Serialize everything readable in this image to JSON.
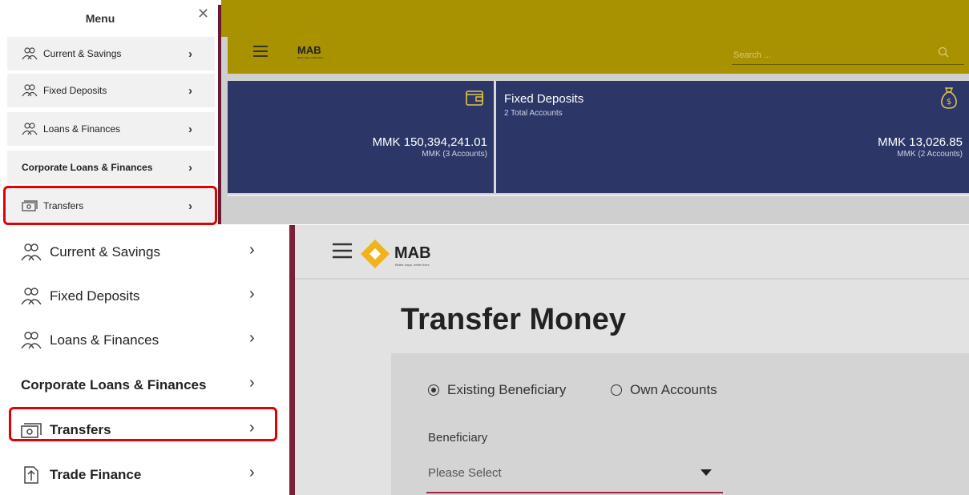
{
  "top_menu": {
    "title": "Menu",
    "close_glyph": "✕",
    "items": [
      {
        "label": "Current & Savings",
        "icon": "users-icon"
      },
      {
        "label": "Fixed Deposits",
        "icon": "users-icon"
      },
      {
        "label": "Loans & Finances",
        "icon": "users-icon"
      },
      {
        "label": "Corporate Loans & Finances",
        "icon": ""
      },
      {
        "label": "Transfers",
        "icon": "cash-icon"
      }
    ],
    "chevron": "›"
  },
  "top_app": {
    "logo": "MAB",
    "logo_tagline": "Better ways, better lives",
    "search_placeholder": "Search ...",
    "cards": [
      {
        "amount": "MMK 150,394,241.01",
        "sub": "MMK (3 Accounts)",
        "icon": "wallet-icon"
      },
      {
        "title": "Fixed Deposits",
        "subtitle": "2 Total Accounts",
        "amount": "MMK 13,026.85",
        "sub": "MMK (2 Accounts)",
        "icon": "money-bag-icon"
      }
    ]
  },
  "bottom_menu": {
    "items": [
      {
        "label": "Current & Savings",
        "icon": "users-icon"
      },
      {
        "label": "Fixed Deposits",
        "icon": "users-icon"
      },
      {
        "label": "Loans & Finances",
        "icon": "users-icon"
      },
      {
        "label": "Corporate Loans & Finances",
        "icon": ""
      },
      {
        "label": "Transfers",
        "icon": "cash-icon"
      },
      {
        "label": "Trade Finance",
        "icon": "document-icon"
      }
    ],
    "chevron": "›"
  },
  "bottom_app": {
    "logo": "MAB",
    "logo_tagline": "Better ways, better lives",
    "page_title": "Transfer Money",
    "radio_options": [
      {
        "label": "Existing Beneficiary",
        "selected": true
      },
      {
        "label": "Own Accounts",
        "selected": false
      }
    ],
    "beneficiary_label": "Beneficiary",
    "beneficiary_select_value": "Please Select"
  },
  "colors": {
    "header_gold": "#a89200",
    "card_navy": "#2c3768",
    "brand_maroon": "#7a2038",
    "highlight_red": "#e20000",
    "logo_gold": "#f2b21b"
  }
}
